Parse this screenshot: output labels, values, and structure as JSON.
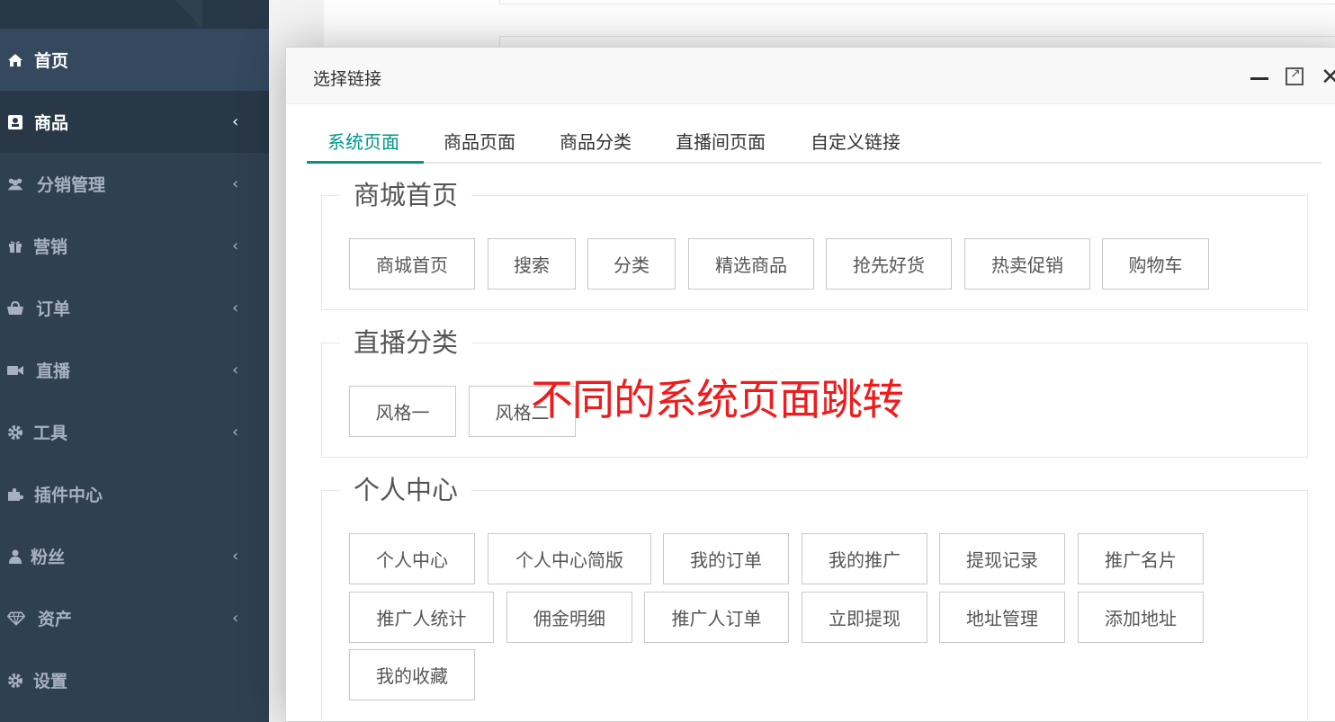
{
  "sidebar": {
    "items": [
      {
        "label": "首页",
        "icon": "home-icon",
        "chevron": ""
      },
      {
        "label": "商品",
        "icon": "product-icon",
        "chevron": "‹"
      },
      {
        "label": "分销管理",
        "icon": "users-icon",
        "chevron": "‹"
      },
      {
        "label": "营销",
        "icon": "gift-icon",
        "chevron": "‹"
      },
      {
        "label": "订单",
        "icon": "bag-icon",
        "chevron": "‹"
      },
      {
        "label": "直播",
        "icon": "video-icon",
        "chevron": "‹"
      },
      {
        "label": "工具",
        "icon": "gear-icon",
        "chevron": "‹"
      },
      {
        "label": "插件中心",
        "icon": "puzzle-icon",
        "chevron": ""
      },
      {
        "label": "粉丝",
        "icon": "user-icon",
        "chevron": "‹"
      },
      {
        "label": "资产",
        "icon": "diamond-icon",
        "chevron": "‹"
      },
      {
        "label": "设置",
        "icon": "gear-icon",
        "chevron": ""
      }
    ],
    "active": "商品"
  },
  "modal": {
    "title": "选择链接",
    "tabs": [
      {
        "label": "系统页面",
        "active": true
      },
      {
        "label": "商品页面",
        "active": false
      },
      {
        "label": "商品分类",
        "active": false
      },
      {
        "label": "直播间页面",
        "active": false
      },
      {
        "label": "自定义链接",
        "active": false
      }
    ],
    "groups": [
      {
        "title": "商城首页",
        "links": [
          "商城首页",
          "搜索",
          "分类",
          "精选商品",
          "抢先好货",
          "热卖促销",
          "购物车"
        ]
      },
      {
        "title": "直播分类",
        "links": [
          "风格一",
          "风格二"
        ]
      },
      {
        "title": "个人中心",
        "links": [
          "个人中心",
          "个人中心简版",
          "我的订单",
          "我的推广",
          "提现记录",
          "推广名片",
          "推广人统计",
          "佣金明细",
          "推广人订单",
          "立即提现",
          "地址管理",
          "添加地址",
          "我的收藏"
        ]
      }
    ]
  },
  "annotation": "不同的系统页面跳转",
  "colors": {
    "sidebar_bg": "#2f4050",
    "accent": "#009688",
    "annotation": "#ee1c1c"
  }
}
